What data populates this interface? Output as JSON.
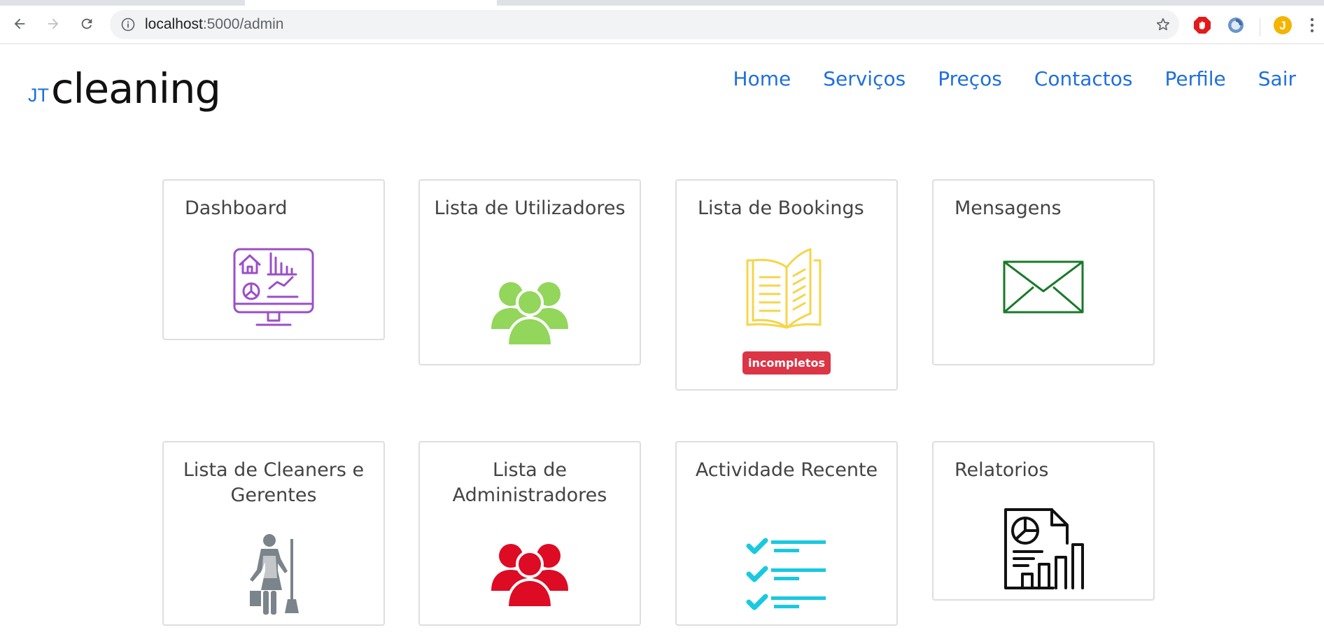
{
  "browser": {
    "url_host": "localhost",
    "url_path": ":5000/admin",
    "profile_initial": "J"
  },
  "brand": {
    "prefix": "JT",
    "name": "cleaning"
  },
  "nav": {
    "home": "Home",
    "servicos": "Serviços",
    "precos": "Preços",
    "contactos": "Contactos",
    "perfile": "Perfile",
    "sair": "Sair"
  },
  "cards": {
    "dashboard": {
      "title": "Dashboard",
      "icon": "dashboard-monitor-icon",
      "color": "#9b4fc8"
    },
    "utilizadores": {
      "title": "Lista de Utilizadores",
      "icon": "users-group-icon",
      "color": "#92d65b"
    },
    "bookings": {
      "title": "Lista de Bookings",
      "icon": "open-book-icon",
      "color": "#f5d54a",
      "badge": "incompletos"
    },
    "mensagens": {
      "title": "Mensagens",
      "icon": "envelope-icon",
      "color": "#1a7a2a"
    },
    "cleaners": {
      "title": "Lista de Cleaners e Gerentes",
      "icon": "cleaner-icon",
      "color": "#7b838b"
    },
    "administradores": {
      "title": "Lista de Administradores",
      "icon": "admins-group-icon",
      "color": "#dd0b24"
    },
    "actividade": {
      "title": "Actividade Recente",
      "icon": "checklist-icon",
      "color": "#19c9e0"
    },
    "relatorios": {
      "title": "Relatorios",
      "icon": "report-icon",
      "color": "#111111"
    }
  }
}
